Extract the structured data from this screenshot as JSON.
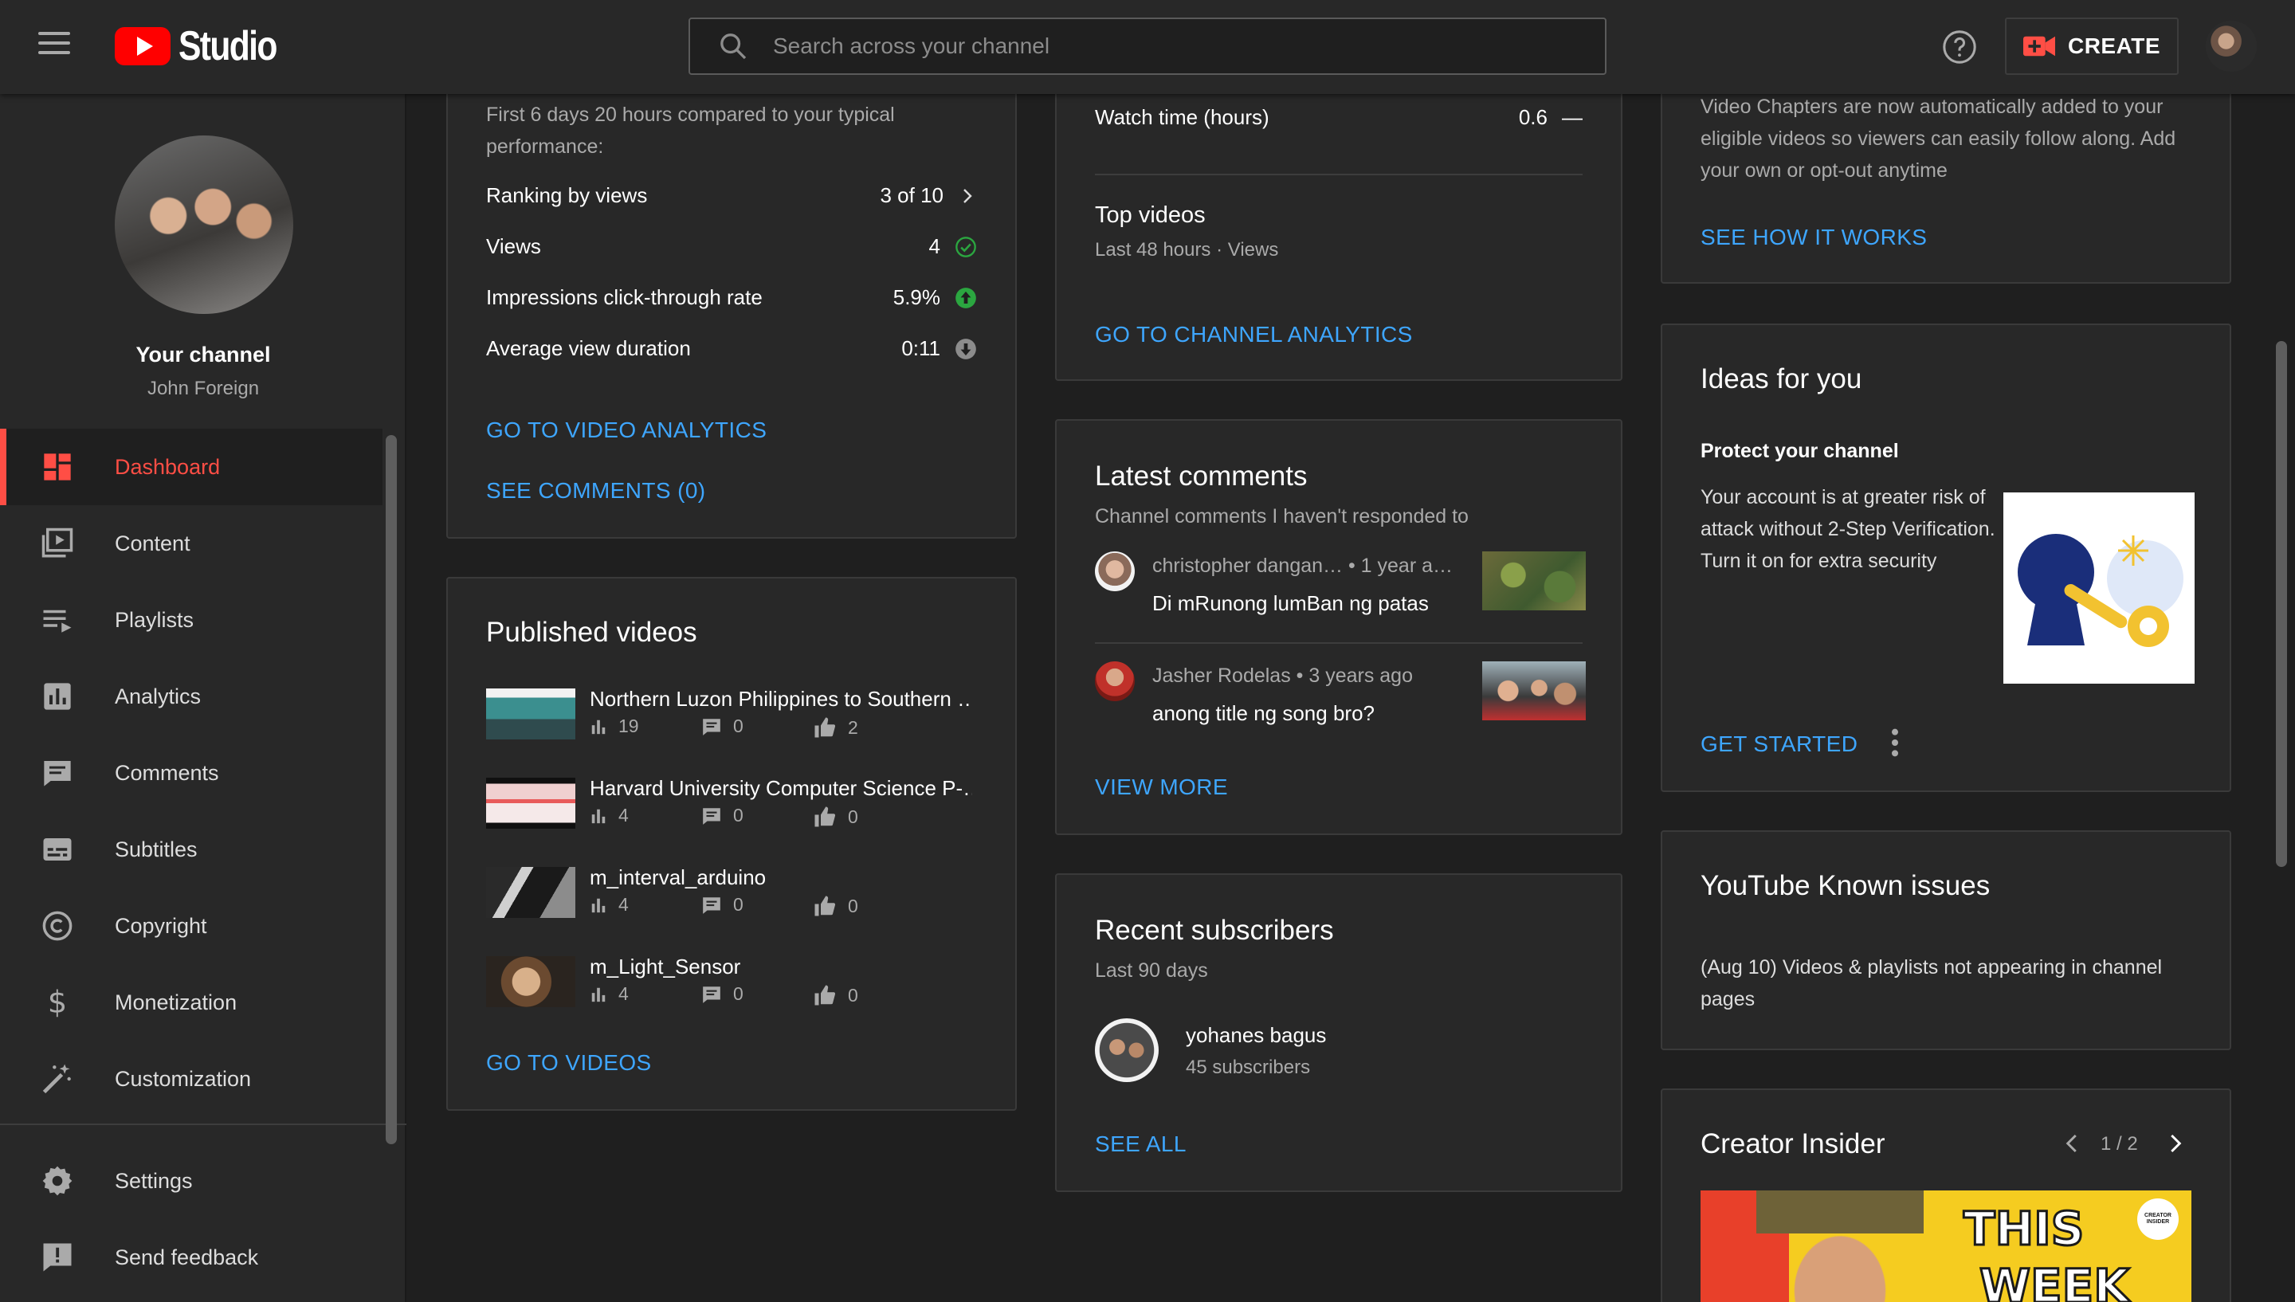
{
  "header": {
    "logo_text": "Studio",
    "search_placeholder": "Search across your channel",
    "create_label": "CREATE"
  },
  "sidebar": {
    "channel_title": "Your channel",
    "channel_name": "John Foreign",
    "items": [
      {
        "label": "Dashboard"
      },
      {
        "label": "Content"
      },
      {
        "label": "Playlists"
      },
      {
        "label": "Analytics"
      },
      {
        "label": "Comments"
      },
      {
        "label": "Subtitles"
      },
      {
        "label": "Copyright"
      },
      {
        "label": "Monetization"
      },
      {
        "label": "Customization"
      }
    ],
    "bottom_items": [
      {
        "label": "Settings"
      },
      {
        "label": "Send feedback"
      }
    ]
  },
  "latest_video": {
    "intro": "First 6 days 20 hours compared to your typical performance:",
    "metrics": [
      {
        "label": "Ranking by views",
        "value": "3 of 10"
      },
      {
        "label": "Views",
        "value": "4"
      },
      {
        "label": "Impressions click-through rate",
        "value": "5.9%"
      },
      {
        "label": "Average view duration",
        "value": "0:11"
      }
    ],
    "link_analytics": "GO TO VIDEO ANALYTICS",
    "link_comments": "SEE COMMENTS (0)"
  },
  "published_videos": {
    "title": "Published videos",
    "videos": [
      {
        "title": "Northern Luzon Philippines to Southern …",
        "views": "19",
        "comments": "0",
        "likes": "2"
      },
      {
        "title": "Harvard University Computer Science P-…",
        "views": "4",
        "comments": "0",
        "likes": "0"
      },
      {
        "title": "m_interval_arduino",
        "views": "4",
        "comments": "0",
        "likes": "0"
      },
      {
        "title": "m_Light_Sensor",
        "views": "4",
        "comments": "0",
        "likes": "0"
      }
    ],
    "link": "GO TO VIDEOS"
  },
  "channel_analytics": {
    "watch_time_label": "Watch time (hours)",
    "watch_time_value": "0.6",
    "watch_time_trend": "—",
    "top_videos_title": "Top videos",
    "top_videos_sub": "Last 48 hours · Views",
    "link": "GO TO CHANNEL ANALYTICS"
  },
  "latest_comments": {
    "title": "Latest comments",
    "subtitle": "Channel comments I haven't responded to",
    "comments": [
      {
        "meta": "christopher dangan… • 1 year a…",
        "text": "Di mRunong lumBan ng patas"
      },
      {
        "meta": "Jasher Rodelas • 3 years ago",
        "text": "anong title ng song bro?"
      }
    ],
    "link": "VIEW MORE"
  },
  "recent_subscribers": {
    "title": "Recent subscribers",
    "subtitle": "Last 90 days",
    "subscriber_name": "yohanes bagus",
    "subscriber_count": "45 subscribers",
    "link": "SEE ALL"
  },
  "chapters_news": {
    "text": "Video Chapters are now automatically added to your eligible videos so viewers can easily follow along. Add your own or opt-out anytime",
    "link": "SEE HOW IT WORKS"
  },
  "ideas": {
    "title": "Ideas for you",
    "subtitle": "Protect your channel",
    "text": "Your account is at greater risk of attack without 2-Step Verification. Turn it on for extra security",
    "link": "GET STARTED"
  },
  "known_issues": {
    "title": "YouTube Known issues",
    "text": "(Aug 10) Videos & playlists not appearing in channel pages"
  },
  "creator_insider": {
    "title": "Creator Insider",
    "pager": "1 / 2",
    "thumb_text_1": "THIS",
    "thumb_text_2": "WEEK",
    "badge": "CREATOR INSIDER"
  },
  "colors": {
    "accent_red": "#ff4e45",
    "link_blue": "#3ea6ff",
    "bg": "#1f1f1f",
    "card_bg": "#282828",
    "success_green": "#2ba640"
  }
}
